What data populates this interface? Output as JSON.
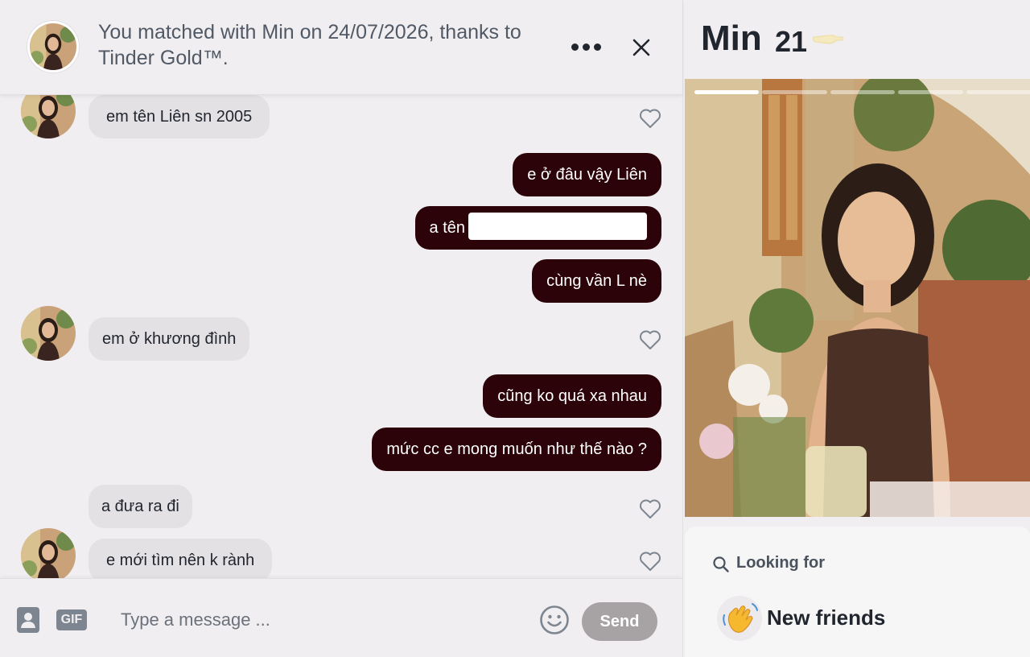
{
  "header": {
    "match_text": "You matched with Min on 24/07/2026, thanks to Tinder Gold™."
  },
  "messages": [
    {
      "direction": "in",
      "text": "em tên Liên sn 2005"
    },
    {
      "direction": "out",
      "text": "e ở đâu vậy Liên"
    },
    {
      "direction": "out",
      "text": "a tên"
    },
    {
      "direction": "out",
      "text": "cùng vần L nè"
    },
    {
      "direction": "in",
      "text": "em ở khương đình"
    },
    {
      "direction": "out",
      "text": "cũng ko quá xa nhau"
    },
    {
      "direction": "out",
      "text": "mức cc e mong muốn như thế nào ?"
    },
    {
      "direction": "in",
      "text": "a đưa ra đi"
    },
    {
      "direction": "in",
      "text": "e mới tìm nên k rành"
    }
  ],
  "composer": {
    "gif_label": "GIF",
    "placeholder": "Type a message ...",
    "send_label": "Send"
  },
  "profile": {
    "name": "Min",
    "age": "21",
    "photo_count": 5,
    "active_photo": 1,
    "looking_for_label": "Looking for",
    "looking_for_value": "New friends"
  },
  "colors": {
    "outgoing_bubble": "#2b0308",
    "incoming_bubble": "#e4e1e4",
    "send_button": "#a7a2a4",
    "background": "#f0eef0"
  }
}
